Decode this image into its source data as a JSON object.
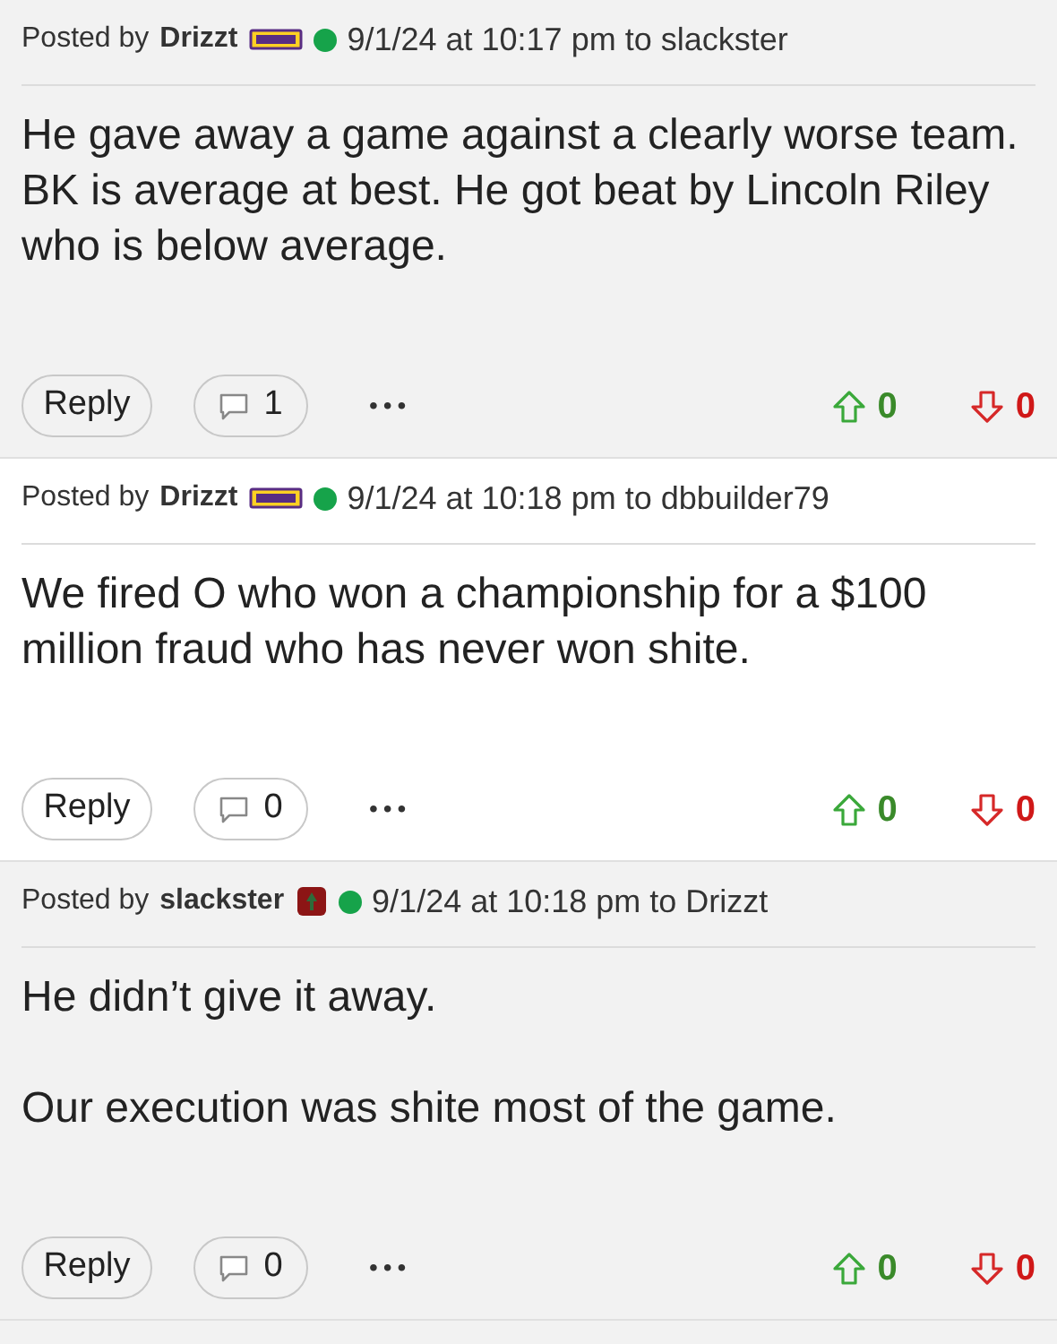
{
  "posts": [
    {
      "shaded": true,
      "posted_by": "Posted by",
      "author": "Drizzt",
      "badge": {
        "kind": "lsu"
      },
      "online": true,
      "timestamp": "9/1/24 at 10:17 pm to slackster",
      "paragraphs": [
        "He gave away a game against a clearly worse team. BK is average at best. He got beat by Lincoln Riley who is below average."
      ],
      "reply": "Reply",
      "replies": "1",
      "more": "•••",
      "upvotes": "0",
      "downvotes": "0"
    },
    {
      "shaded": false,
      "posted_by": "Posted by",
      "author": "Drizzt",
      "badge": {
        "kind": "lsu"
      },
      "online": true,
      "timestamp": "9/1/24 at 10:18 pm to dbbuilder79",
      "paragraphs": [
        "We fired O who won a championship for a $100 million fraud who has never won shite."
      ],
      "reply": "Reply",
      "replies": "0",
      "more": "•••",
      "upvotes": "0",
      "downvotes": "0"
    },
    {
      "shaded": true,
      "posted_by": "Posted by",
      "author": "slackster",
      "badge": {
        "kind": "stanford"
      },
      "online": true,
      "timestamp": "9/1/24 at 10:18 pm to Drizzt",
      "paragraphs": [
        "He didn’t give it away.",
        "Our execution was shite most of the game."
      ],
      "reply": "Reply",
      "replies": "0",
      "more": "•••",
      "upvotes": "0",
      "downvotes": "0"
    }
  ]
}
